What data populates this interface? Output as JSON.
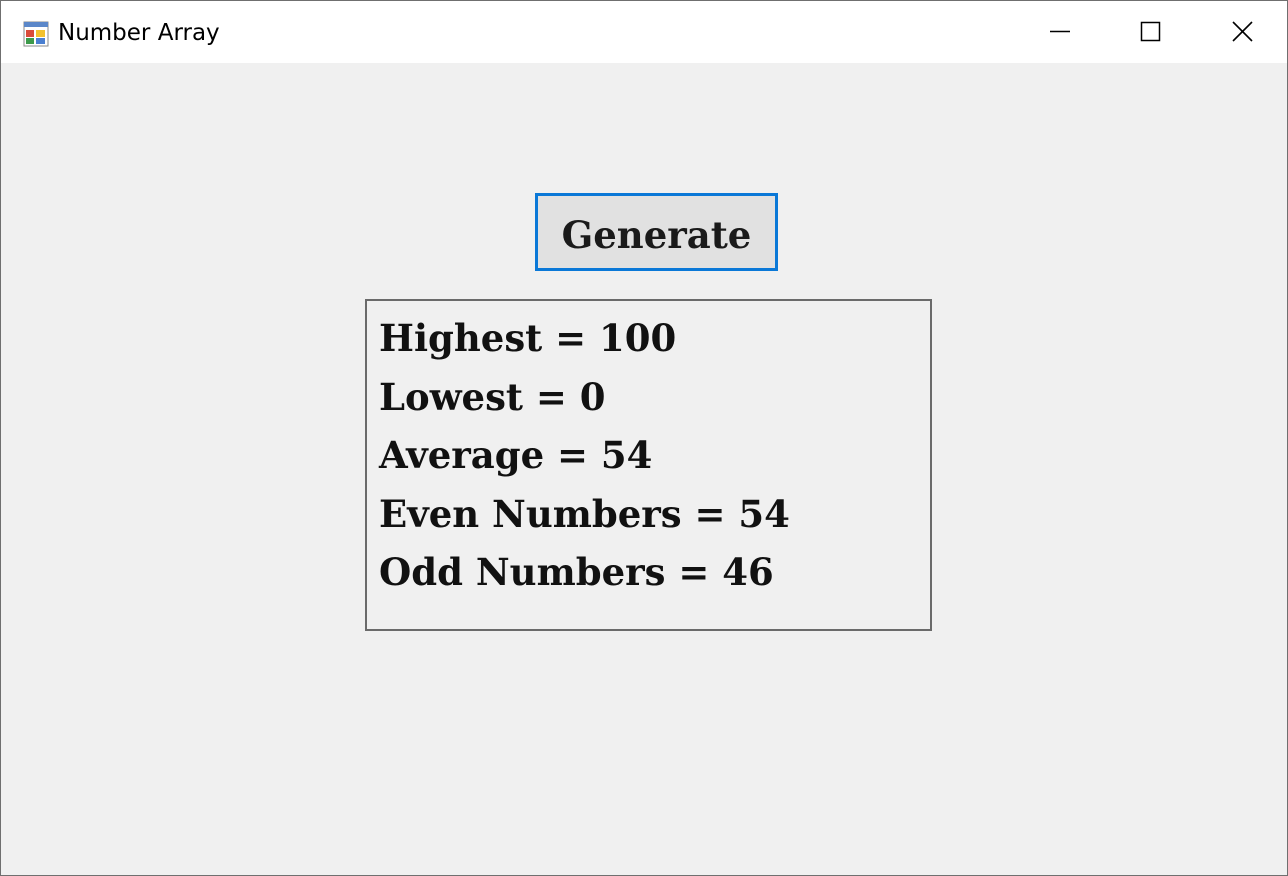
{
  "window": {
    "title": "Number Array",
    "app_icon": "winforms-app-icon",
    "controls": {
      "minimize_icon": "minimize-icon",
      "maximize_icon": "maximize-icon",
      "close_icon": "close-icon"
    }
  },
  "form": {
    "generate_label": "Generate",
    "results": [
      "Highest = 100",
      "Lowest = 0",
      "Average = 54",
      "Even Numbers = 54",
      "Odd Numbers = 46"
    ]
  },
  "colors": {
    "focus_border": "#0a78d7",
    "form_background": "#f0f0f0",
    "button_face": "#e1e1e1"
  }
}
